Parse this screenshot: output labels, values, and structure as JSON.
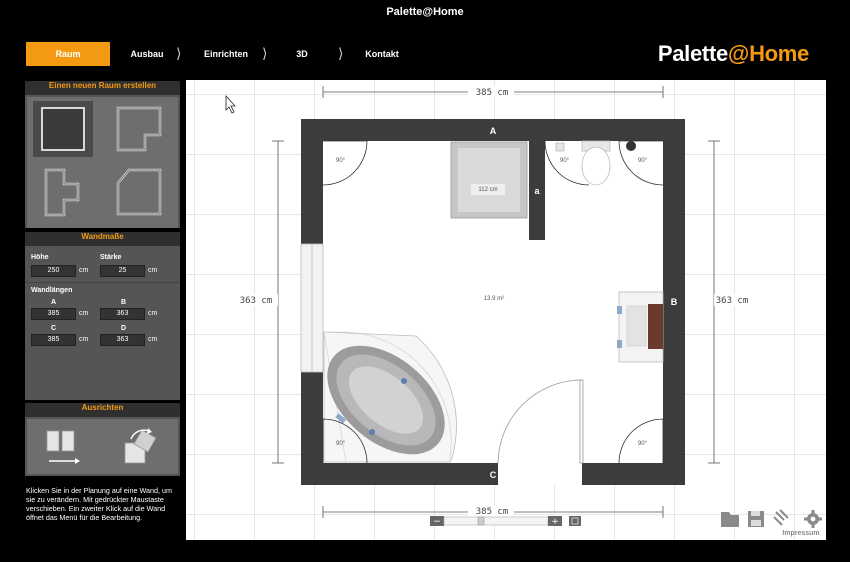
{
  "window": {
    "title": "Palette@Home"
  },
  "nav": {
    "tabs": [
      {
        "label": "Raum",
        "active": true
      },
      {
        "label": "Ausbau",
        "active": false
      },
      {
        "label": "Einrichten",
        "active": false
      },
      {
        "label": "3D",
        "active": false
      },
      {
        "label": "Kontakt",
        "active": false
      }
    ],
    "logo_left": "Palette",
    "logo_right": "@Home"
  },
  "sidebar": {
    "new_room": {
      "title": "Einen neuen Raum erstellen"
    },
    "wall_dims": {
      "title": "Wandmaße",
      "height_label": "Höhe",
      "height_value": "250",
      "thickness_label": "Stärke",
      "thickness_value": "25",
      "unit": "cm",
      "lengths_label": "Wandlängen",
      "walls": [
        {
          "name": "A",
          "value": "385"
        },
        {
          "name": "B",
          "value": "363"
        },
        {
          "name": "C",
          "value": "385"
        },
        {
          "name": "D",
          "value": "363"
        }
      ]
    },
    "align": {
      "title": "Ausrichten"
    },
    "help_text": "Klicken Sie in der Planung auf eine Wand, um sie zu verändern. Mit gedrückter Maustaste verschieben. Ein zweiter Klick auf die Wand öffnet das Menü für die Bearbeitung."
  },
  "plan": {
    "dim_top": "385 cm",
    "dim_bottom": "385 cm",
    "dim_left": "363 cm",
    "dim_right": "363 cm",
    "wall_a": "A",
    "wall_b": "B",
    "wall_c": "C",
    "wall_small_a": "a",
    "area": "13.9 m²",
    "shower_size": "112 cm",
    "angle": "90°",
    "zoom_minus": "−",
    "zoom_plus": "+"
  },
  "footer": {
    "impressum": "Impressum"
  },
  "colors": {
    "accent": "#f39a12",
    "wall": "#3c3c3c",
    "panel": "#555555"
  }
}
